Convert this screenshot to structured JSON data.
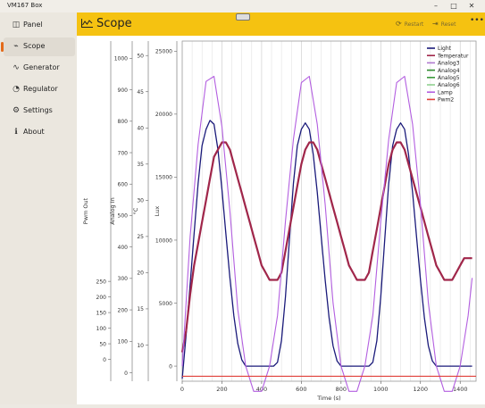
{
  "window": {
    "title": "VM167 Box"
  },
  "sidebar": {
    "items": [
      {
        "label": "Panel",
        "icon": "panel-icon"
      },
      {
        "label": "Scope",
        "icon": "scope-icon",
        "active": true
      },
      {
        "label": "Generator",
        "icon": "wave-icon"
      },
      {
        "label": "Regulator",
        "icon": "gauge-icon"
      },
      {
        "label": "Settings",
        "icon": "gear-icon"
      },
      {
        "label": "About",
        "icon": "info-icon"
      }
    ]
  },
  "header": {
    "title": "Scope",
    "restart_label": "Restart",
    "reset_label": "Reset"
  },
  "colors": {
    "accent": "#f5c211",
    "active_marker": "#e36a1a"
  },
  "chart_data": {
    "type": "line",
    "xlabel": "Time (s)",
    "xlim": [
      0,
      1480
    ],
    "x_ticks": [
      0,
      200,
      400,
      600,
      800,
      1000,
      1200,
      1400
    ],
    "grid": true,
    "legend_position": "top-right",
    "axes": [
      {
        "label": "Pwm Out",
        "lim": [
          -70,
          1020
        ],
        "ticks": [
          0,
          50,
          100,
          150,
          200,
          250
        ]
      },
      {
        "label": "Analog In",
        "lim": [
          -27,
          1055
        ],
        "ticks": [
          0,
          100,
          200,
          300,
          400,
          500,
          600,
          700,
          800,
          900,
          1000
        ]
      },
      {
        "label": "°C",
        "lim": [
          5,
          52
        ],
        "ticks": [
          10,
          15,
          20,
          25,
          30,
          35,
          40,
          45,
          50
        ]
      },
      {
        "label": "Lux",
        "lim": [
          -1200,
          25800
        ],
        "ticks": [
          0,
          5000,
          10000,
          15000,
          20000,
          25000
        ]
      }
    ],
    "series": [
      {
        "name": "Light",
        "color": "#1a1a7a",
        "axis": "Lux",
        "x": [
          0,
          20,
          40,
          60,
          80,
          100,
          120,
          140,
          160,
          180,
          200,
          220,
          240,
          260,
          280,
          300,
          320,
          340,
          360,
          380,
          400,
          420,
          440,
          460,
          480,
          500,
          520,
          540,
          560,
          580,
          600,
          620,
          640,
          660,
          680,
          700,
          720,
          740,
          760,
          780,
          800,
          820,
          840,
          860,
          880,
          900,
          920,
          940,
          960,
          980,
          1000,
          1020,
          1040,
          1060,
          1080,
          1100,
          1120,
          1140,
          1160,
          1180,
          1200,
          1220,
          1240,
          1260,
          1280,
          1300,
          1320,
          1340,
          1360,
          1380,
          1400,
          1420,
          1440,
          1460
        ],
        "y": [
          -1000,
          2500,
          6500,
          10500,
          14500,
          17500,
          18800,
          19500,
          19200,
          17200,
          14000,
          10500,
          7000,
          4000,
          1800,
          500,
          0,
          0,
          0,
          0,
          0,
          0,
          0,
          0,
          300,
          2000,
          5500,
          10000,
          14500,
          17500,
          18800,
          19300,
          18800,
          16800,
          13800,
          10300,
          6800,
          3800,
          1600,
          400,
          0,
          0,
          0,
          0,
          0,
          0,
          0,
          0,
          300,
          2000,
          5500,
          10000,
          14500,
          17500,
          18800,
          19300,
          18800,
          16800,
          13800,
          10300,
          6800,
          3800,
          1600,
          400,
          0,
          0,
          0,
          0,
          0,
          0,
          0,
          0,
          0,
          0
        ]
      },
      {
        "name": "Temperatur",
        "color": "#a0264a",
        "axis": "°C",
        "x": [
          0,
          20,
          40,
          60,
          80,
          100,
          120,
          140,
          160,
          180,
          200,
          220,
          240,
          260,
          280,
          300,
          320,
          340,
          360,
          380,
          400,
          420,
          440,
          460,
          480,
          500,
          520,
          540,
          560,
          580,
          600,
          620,
          640,
          660,
          680,
          700,
          720,
          740,
          760,
          780,
          800,
          820,
          840,
          860,
          880,
          900,
          920,
          940,
          960,
          980,
          1000,
          1020,
          1040,
          1060,
          1080,
          1100,
          1120,
          1140,
          1160,
          1180,
          1200,
          1220,
          1240,
          1260,
          1280,
          1300,
          1320,
          1340,
          1360,
          1380,
          1400,
          1420,
          1440,
          1460
        ],
        "y": [
          9,
          12,
          17,
          21,
          24,
          27,
          30,
          33,
          36,
          37,
          38,
          38,
          37,
          35,
          33,
          31,
          29,
          27,
          25,
          23,
          21,
          20,
          19,
          19,
          19,
          20,
          23,
          26,
          29,
          32,
          35,
          37,
          38,
          38,
          37,
          35,
          33,
          31,
          29,
          27,
          25,
          23,
          21,
          20,
          19,
          19,
          19,
          20,
          23,
          26,
          29,
          32,
          35,
          37,
          38,
          38,
          37,
          35,
          33,
          31,
          29,
          27,
          25,
          23,
          21,
          20,
          19,
          19,
          19,
          20,
          21,
          22,
          22,
          22
        ]
      },
      {
        "name": "Analog3",
        "color": "#b07ad0",
        "axis": "Lux",
        "x": [],
        "y": []
      },
      {
        "name": "Analog4",
        "color": "#2e8b2e",
        "axis": "Lux",
        "x": [],
        "y": []
      },
      {
        "name": "Analog5",
        "color": "#3a9a3a",
        "axis": "Lux",
        "x": [],
        "y": []
      },
      {
        "name": "Analog6",
        "color": "#8fd08f",
        "axis": "Lux",
        "x": [],
        "y": []
      },
      {
        "name": "Lamp",
        "color": "#b35fe0",
        "axis": "Lux",
        "x": [
          0,
          40,
          80,
          120,
          160,
          200,
          240,
          280,
          320,
          360,
          400,
          440,
          480,
          520,
          560,
          600,
          640,
          680,
          720,
          760,
          800,
          840,
          880,
          920,
          960,
          1000,
          1040,
          1080,
          1120,
          1160,
          1200,
          1240,
          1280,
          1320,
          1360,
          1400,
          1440,
          1460
        ],
        "y": [
          0,
          10300,
          17600,
          22600,
          23000,
          19000,
          12300,
          4500,
          0,
          -2000,
          -2000,
          0,
          4000,
          11500,
          18000,
          22500,
          23000,
          19200,
          12800,
          5000,
          0,
          -2000,
          -2000,
          0,
          4000,
          11500,
          18000,
          22500,
          23000,
          19200,
          12800,
          5000,
          0,
          -2000,
          -2000,
          0,
          4000,
          7000
        ]
      },
      {
        "name": "Pwm2",
        "color": "#e0403a",
        "axis": "Lux",
        "x": [
          0,
          1480
        ],
        "y": [
          -800,
          -800
        ]
      }
    ]
  }
}
